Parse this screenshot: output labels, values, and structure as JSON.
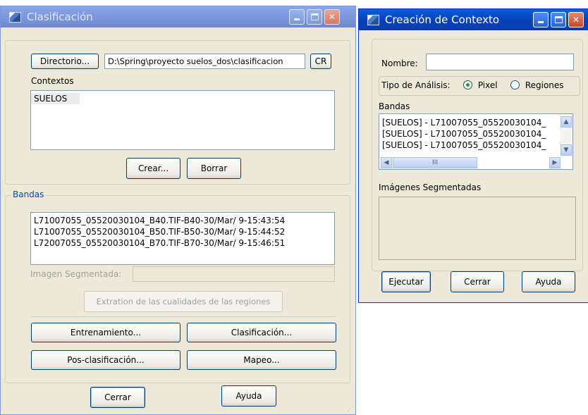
{
  "left_window": {
    "title": "Clasificación",
    "directory_button": "Directorio...",
    "directory_path": "D:\\Spring\\proyecto suelos_dos\\clasificacion",
    "cr_button": "CR",
    "contexts_label": "Contextos",
    "contexts": [
      "SUELOS"
    ],
    "create_button": "Crear...",
    "delete_button": "Borrar",
    "bands_label": "Bandas",
    "bands": [
      "L71007055_05520030104_B40.TIF-B40-30/Mar/ 9-15:43:54",
      "L71007055_05520030104_B50.TIF-B50-30/Mar/ 9-15:44:52",
      "L72007055_05520030104_B70.TIF-B70-30/Mar/ 9-15:46:51"
    ],
    "segmented_image_label": "Imagen Segmentada:",
    "segmented_image_value": "",
    "extract_button": "Extration de las cualidades de las regiones",
    "training_button": "Entrenamiento...",
    "classification_button": "Clasificación...",
    "postclass_button": "Pos-clasificación...",
    "mapping_button": "Mapeo...",
    "close_button": "Cerrar",
    "help_button": "Ayuda"
  },
  "right_window": {
    "title": "Creación de Contexto",
    "name_label": "Nombre:",
    "name_value": "",
    "analysis_label": "Tipo de Análisis:",
    "analysis_options": [
      "Pixel",
      "Regiones"
    ],
    "analysis_selected": "Pixel",
    "bands_label": "Bandas",
    "bands": [
      "[SUELOS] - L71007055_05520030104_",
      "[SUELOS] - L71007055_05520030104_",
      "[SUELOS] - L71007055_05520030104_"
    ],
    "scroll_thumb_glyph": "III",
    "segmented_images_label": "Imágenes Segmentadas",
    "segmented_images": [],
    "execute_button": "Ejecutar",
    "close_button": "Cerrar",
    "help_button": "Ayuda"
  },
  "colors": {
    "window_bg": "#ece9d8",
    "active_title": "#0a5ddc",
    "inactive_title": "#8ba7e8",
    "group_label": "#0046d5"
  }
}
